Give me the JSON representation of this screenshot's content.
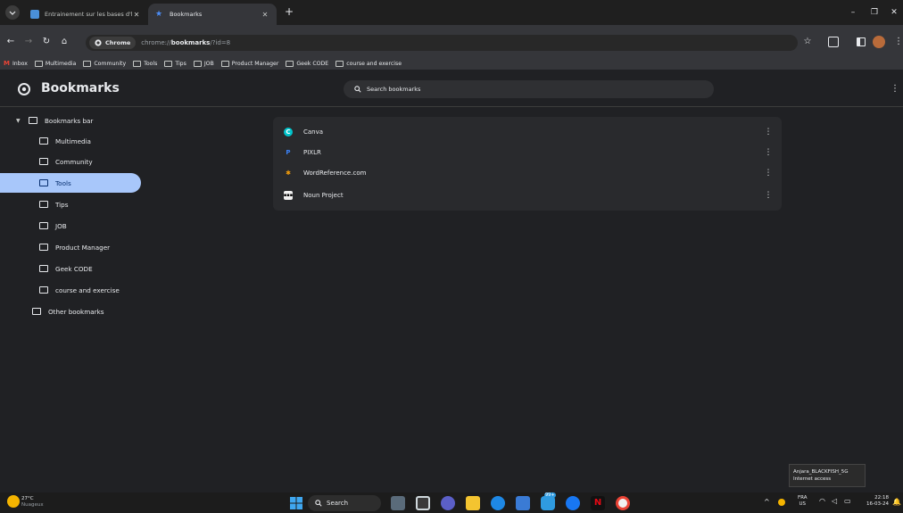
{
  "tabs": [
    {
      "title": "Entrainement sur les bases d'le",
      "close": "✕",
      "color": "#4a90d9"
    },
    {
      "title": "Bookmarks",
      "close": "✕",
      "color": "#4c8df6"
    }
  ],
  "newtab_label": "+",
  "window_controls": {
    "minimize": "–",
    "restore": "❐",
    "close": "✕"
  },
  "nav": {
    "back": "←",
    "forward": "→",
    "reload": "↻",
    "home": "⌂"
  },
  "omnibox": {
    "chip_label": "Chrome",
    "url_scheme": "chrome://",
    "url_host": "bookmarks",
    "url_rest": "/?id=8"
  },
  "bookmarks_bar": [
    {
      "label": "Inbox",
      "icon": "gmail-icon"
    },
    {
      "label": "Multimedia",
      "icon": "folder-icon"
    },
    {
      "label": "Community",
      "icon": "folder-icon"
    },
    {
      "label": "Tools",
      "icon": "folder-icon"
    },
    {
      "label": "Tips",
      "icon": "folder-icon"
    },
    {
      "label": "JOB",
      "icon": "folder-icon"
    },
    {
      "label": "Product Manager",
      "icon": "folder-icon"
    },
    {
      "label": "Geek CODE",
      "icon": "folder-icon"
    },
    {
      "label": "course and exercise",
      "icon": "folder-icon"
    }
  ],
  "page": {
    "title": "Bookmarks",
    "search_placeholder": "Search bookmarks",
    "menu": "⋮"
  },
  "sidebar": {
    "root": {
      "label": "Bookmarks bar",
      "arrow": "▼"
    },
    "items": [
      {
        "label": "Multimedia"
      },
      {
        "label": "Community"
      },
      {
        "label": "Tools",
        "selected": true
      },
      {
        "label": "Tips"
      },
      {
        "label": "JOB"
      },
      {
        "label": "Product Manager"
      },
      {
        "label": "Geek CODE"
      },
      {
        "label": "course and exercise"
      }
    ],
    "other": {
      "label": "Other bookmarks"
    }
  },
  "list": [
    {
      "title": "Canva",
      "icon": "canva-icon",
      "color": "#00c4cc",
      "more": "⋮"
    },
    {
      "title": "PIXLR",
      "icon": "pixlr-icon",
      "color": "#3b82f6",
      "more": "⋮"
    },
    {
      "title": "WordReference.com",
      "icon": "wordreference-icon",
      "color": "#f59e0b",
      "more": "⋮"
    },
    {
      "title": "Noun Project",
      "icon": "nounproject-icon",
      "color": "#000000",
      "more": "⋮"
    }
  ],
  "tooltip": {
    "line1": "Anjara_BLACKFISH_5G",
    "line2": "Internet access"
  },
  "taskbar": {
    "weather_temp": "27°C",
    "weather_desc": "Nuageux",
    "search_label": "Search",
    "badge": "99+",
    "lang1": "FRA",
    "lang2": "US",
    "time": "22:18",
    "date": "16-03-24"
  }
}
